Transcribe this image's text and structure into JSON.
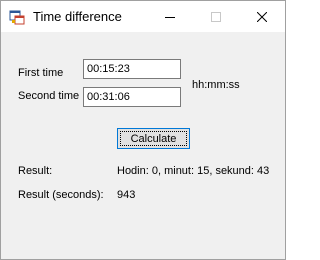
{
  "window": {
    "title": "Time difference",
    "icon": "winforms-app-icon"
  },
  "titlebar": {
    "minimize_icon": "minimize-icon",
    "maximize_icon": "maximize-icon",
    "close_icon": "close-icon"
  },
  "form": {
    "first_time_label": "First time",
    "first_time_value": "00:15:23",
    "second_time_label": "Second time",
    "second_time_value": "00:31:06",
    "format_hint": "hh:mm:ss",
    "calculate_label": "Calculate",
    "result_label": "Result:",
    "result_value": "Hodin: 0, minut: 15, sekund: 43",
    "result_seconds_label": "Result (seconds):",
    "result_seconds_value": "943"
  },
  "colors": {
    "accent": "#0078d7",
    "window_bg": "#f0f0f0"
  }
}
